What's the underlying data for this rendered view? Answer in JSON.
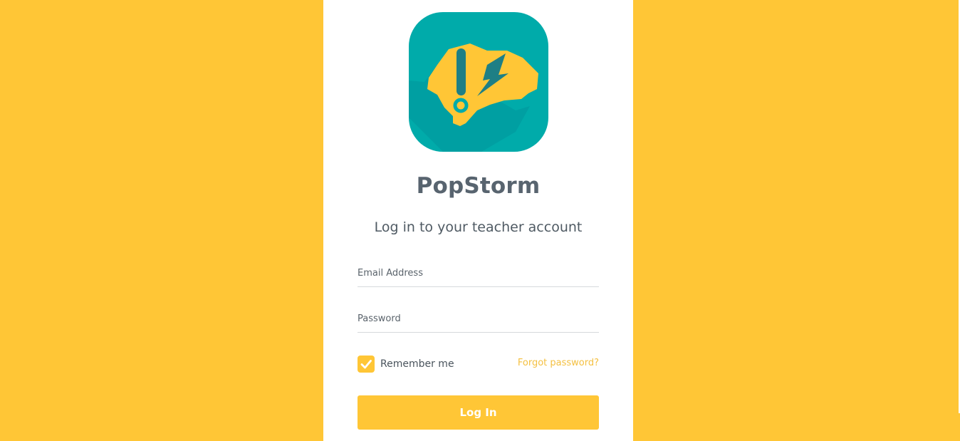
{
  "brand": {
    "app_name": "PopStorm",
    "logo_icon": "brain-lightning-icon",
    "primary_color": "#FFC636",
    "logo_background_color": "#00ABAA"
  },
  "login_form": {
    "title": "Log in to your teacher account",
    "email_placeholder": "Email Address",
    "email_value": "",
    "password_placeholder": "Password",
    "password_value": "",
    "remember_label": "Remember me",
    "remember_checked": true,
    "forgot_password_label": "Forgot password?",
    "submit_label": "Log In"
  }
}
